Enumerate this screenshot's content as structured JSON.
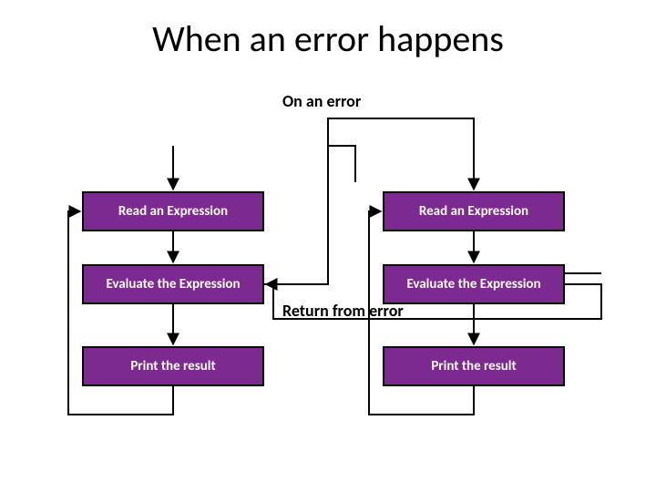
{
  "title": "When an error happens",
  "labels": {
    "on_error": "On an error",
    "return_from_error": "Return from error"
  },
  "left": {
    "read": "Read an Expression",
    "eval": "Evaluate the Expression",
    "print": "Print the result"
  },
  "right": {
    "read": "Read an Expression",
    "eval": "Evaluate the Expression",
    "print": "Print the result"
  },
  "colors": {
    "box_fill": "#7d2a90",
    "box_border": "#000000"
  }
}
